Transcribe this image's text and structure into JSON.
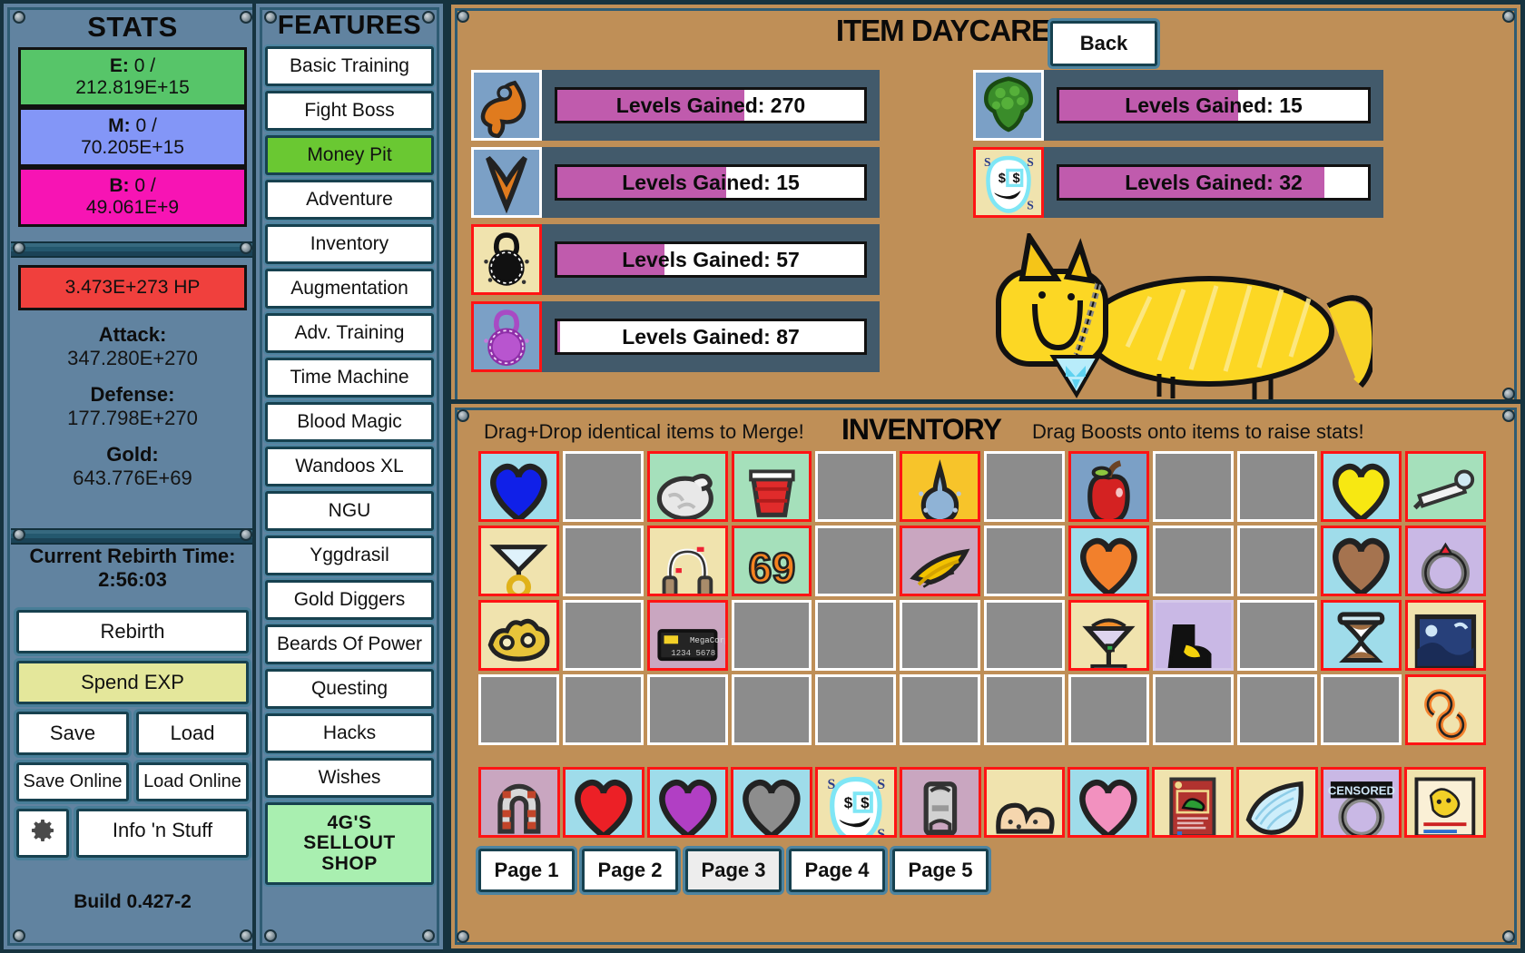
{
  "stats": {
    "title": "STATS",
    "bars": [
      {
        "name": "energy",
        "label": "E:",
        "current": "0",
        "max": "212.819E+15",
        "color": "#57c569"
      },
      {
        "name": "magic",
        "label": "M:",
        "current": "0",
        "max": "70.205E+15",
        "color": "#8396f7"
      },
      {
        "name": "resource3",
        "label": "B:",
        "current": "0",
        "max": "49.061E+9",
        "color": "#f714b4"
      }
    ],
    "hp": "3.473E+273 HP",
    "attack_label": "Attack:",
    "attack_value": "347.280E+270",
    "defense_label": "Defense:",
    "defense_value": "177.798E+270",
    "gold_label": "Gold:",
    "gold_value": "643.776E+69",
    "rebirth_time_label": "Current Rebirth Time:",
    "rebirth_time_value": "2:56:03",
    "buttons": {
      "rebirth": "Rebirth",
      "spend_exp": "Spend EXP",
      "save": "Save",
      "load": "Load",
      "save_online": "Save Online",
      "load_online": "Load Online",
      "info": "Info 'n Stuff"
    },
    "build": "Build 0.427-2"
  },
  "features": {
    "title": "FEATURES",
    "items": [
      {
        "label": "Basic Training",
        "active": false
      },
      {
        "label": "Fight Boss",
        "active": false
      },
      {
        "label": "Money Pit",
        "active": true
      },
      {
        "label": "Adventure",
        "active": false
      },
      {
        "label": "Inventory",
        "active": false
      },
      {
        "label": "Augmentation",
        "active": false
      },
      {
        "label": "Adv. Training",
        "active": false
      },
      {
        "label": "Time Machine",
        "active": false
      },
      {
        "label": "Blood Magic",
        "active": false
      },
      {
        "label": "Wandoos XL",
        "active": false
      },
      {
        "label": "NGU",
        "active": false
      },
      {
        "label": "Yggdrasil",
        "active": false
      },
      {
        "label": "Gold Diggers",
        "active": false
      },
      {
        "label": "Beards Of Power",
        "active": false
      },
      {
        "label": "Questing",
        "active": false
      },
      {
        "label": "Hacks",
        "active": false
      },
      {
        "label": "Wishes",
        "active": false
      }
    ],
    "sellout_shop": "4G'S\nSELLOUT\nSHOP"
  },
  "daycare": {
    "title": "ITEM DAYCARE",
    "back_label": "Back",
    "left_slots": [
      {
        "icon": "wrench-item",
        "levels_label": "Levels Gained: 270",
        "progress": 61,
        "rare": false,
        "bg": "#7ba0c6"
      },
      {
        "icon": "boomerang-item",
        "levels_label": "Levels Gained: 15",
        "progress": 55,
        "rare": false,
        "bg": "#7ba0c6"
      },
      {
        "icon": "black-amulet-item",
        "levels_label": "Levels Gained: 57",
        "progress": 35,
        "rare": true,
        "bg": "#f0e3ae"
      },
      {
        "icon": "purple-amulet-item",
        "levels_label": "Levels Gained: 87",
        "progress": 1,
        "rare": true,
        "bg": "#7ba0c6"
      }
    ],
    "right_slots": [
      {
        "icon": "broccoli-item",
        "levels_label": "Levels Gained: 15",
        "progress": 58,
        "rare": false,
        "bg": "#7ba0c6"
      },
      {
        "icon": "money-ghost-item",
        "levels_label": "Levels Gained: 32",
        "progress": 86,
        "rare": true,
        "bg": "#f0e3ae"
      }
    ],
    "cat": "yellow-cat-mascot"
  },
  "inventory": {
    "title": "INVENTORY",
    "hint_left": "Drag+Drop identical items to Merge!",
    "hint_right": "Drag Boosts onto items to raise stats!",
    "grid": [
      [
        {
          "item": "blue-heart",
          "bg": "#9fdcea",
          "border": "red"
        },
        {
          "item": null
        },
        {
          "item": "brain",
          "bg": "#a5e0bb",
          "border": "red"
        },
        {
          "item": "red-cup",
          "bg": "#a5e0bb",
          "border": "red"
        },
        {
          "item": null
        },
        {
          "item": "blue-gem-charm",
          "bg": "#f7c42a",
          "border": "red"
        },
        {
          "item": null
        },
        {
          "item": "red-apple",
          "bg": "#7ba0c6",
          "border": "red"
        },
        {
          "item": null
        },
        {
          "item": null
        },
        {
          "item": "yellow-heart",
          "bg": "#9fdcea",
          "border": "red"
        },
        {
          "item": "white-pen",
          "bg": "#a5e0bb",
          "border": "red"
        }
      ],
      [
        {
          "item": "diamond-necklace",
          "bg": "#f0e3ae",
          "border": "red"
        },
        {
          "item": null
        },
        {
          "item": "earbuds",
          "bg": "#f0e3ae",
          "border": "red"
        },
        {
          "item": "sixty-nine",
          "bg": "#a5e0bb",
          "border": "red"
        },
        {
          "item": null
        },
        {
          "item": "yellow-leaf",
          "bg": "#c9a6c0",
          "border": "red"
        },
        {
          "item": null
        },
        {
          "item": "orange-heart",
          "bg": "#9fdcea",
          "border": "red"
        },
        {
          "item": null
        },
        {
          "item": null
        },
        {
          "item": "brown-heart",
          "bg": "#9fdcea",
          "border": "red"
        },
        {
          "item": "purple-ring",
          "bg": "#c9b8e5",
          "border": "red"
        }
      ],
      [
        {
          "item": "gold-knuckles",
          "bg": "#f0e3ae",
          "border": "red"
        },
        {
          "item": null
        },
        {
          "item": "dark-card",
          "bg": "#c9a6c0",
          "border": "red"
        },
        {
          "item": null
        },
        {
          "item": null
        },
        {
          "item": null
        },
        {
          "item": null
        },
        {
          "item": "cocktail-glass",
          "bg": "#f0e3ae",
          "border": "red"
        },
        {
          "item": "black-boot",
          "bg": "#c9b8e5",
          "border": "lav"
        },
        {
          "item": null
        },
        {
          "item": "hourglass",
          "bg": "#9fdcea",
          "border": "red"
        },
        {
          "item": "starry-night",
          "bg": "#f0e3ae",
          "border": "red"
        }
      ],
      [
        {
          "item": null
        },
        {
          "item": null
        },
        {
          "item": null
        },
        {
          "item": null
        },
        {
          "item": null
        },
        {
          "item": null
        },
        {
          "item": null
        },
        {
          "item": null
        },
        {
          "item": null
        },
        {
          "item": null
        },
        {
          "item": null
        },
        {
          "item": "infinity-loop",
          "bg": "#f0e3ae",
          "border": "red"
        }
      ]
    ],
    "equipped": [
      {
        "item": "horseshoe-magnet",
        "bg": "#c9a6c0",
        "border": "red"
      },
      {
        "item": "red-heart",
        "bg": "#9fdcea",
        "border": "red"
      },
      {
        "item": "purple-heart",
        "bg": "#9fdcea",
        "border": "red"
      },
      {
        "item": "grey-heart",
        "bg": "#9fdcea",
        "border": "red"
      },
      {
        "item": "money-ghost",
        "bg": "#f0e3ae",
        "border": "red"
      },
      {
        "item": "grey-canister",
        "bg": "#c9a6c0",
        "border": "red"
      },
      {
        "item": "peach-bum",
        "bg": "#f0e3ae",
        "border": "red"
      },
      {
        "item": "pink-heart",
        "bg": "#9fdcea",
        "border": "red"
      },
      {
        "item": "monster-card",
        "bg": "#f0e3ae",
        "border": "red"
      },
      {
        "item": "ice-wing",
        "bg": "#f0e3ae",
        "border": "red"
      },
      {
        "item": "censored-ring",
        "bg": "#c9b8e5",
        "border": "red"
      },
      {
        "item": "comic-page",
        "bg": "#f0e3ae",
        "border": "red"
      }
    ],
    "pages": [
      {
        "label": "Page 1",
        "selected": false
      },
      {
        "label": "Page 2",
        "selected": false
      },
      {
        "label": "Page 3",
        "selected": true
      },
      {
        "label": "Page 4",
        "selected": false
      },
      {
        "label": "Page 5",
        "selected": false
      }
    ]
  },
  "colors": {
    "accent_green": "#6ac832",
    "panel_blue": "#5f819b",
    "brown_panel": "#bf8f57",
    "progress_pink": "#c05bad",
    "rare_border": "#ff1414"
  }
}
